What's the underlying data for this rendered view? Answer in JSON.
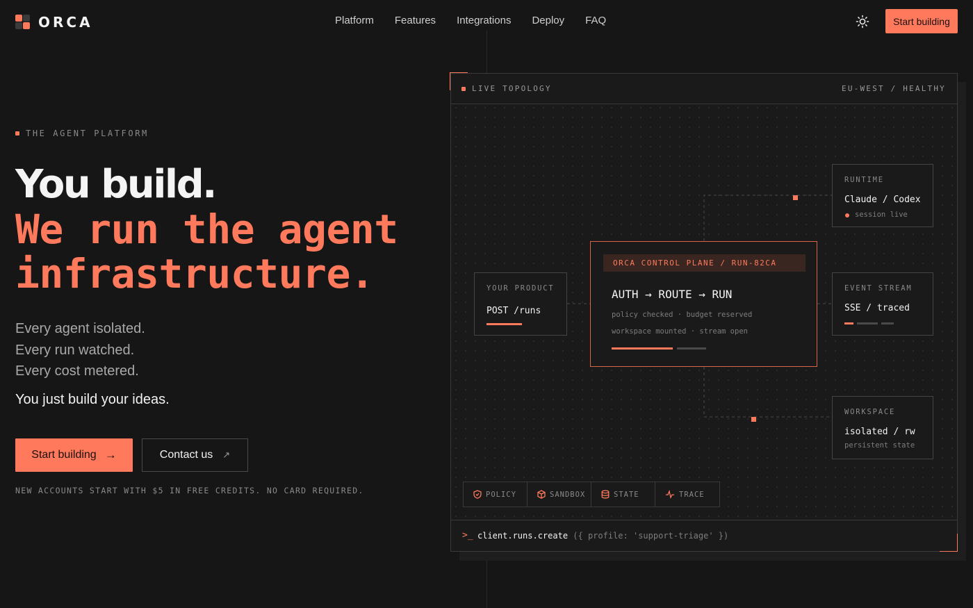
{
  "brand": {
    "name": "ORCA"
  },
  "nav": {
    "links": [
      "Platform",
      "Features",
      "Integrations",
      "Deploy",
      "FAQ"
    ],
    "cta": "Start building",
    "theme_icon": "sun-icon"
  },
  "hero": {
    "eyebrow": "THE AGENT PLATFORM",
    "headline_1": "You build.",
    "headline_2": "We run the agent infrastructure.",
    "lines": [
      "Every agent isolated.",
      "Every run watched.",
      "Every cost metered."
    ],
    "tagline": "You just build your ideas.",
    "primary_cta": "Start building",
    "secondary_cta": "Contact us",
    "fineprint": "NEW ACCOUNTS START WITH $5 IN FREE CREDITS. NO CARD REQUIRED."
  },
  "topology": {
    "label": "LIVE TOPOLOGY",
    "status": "EU-WEST / HEALTHY",
    "product": {
      "label": "YOUR PRODUCT",
      "value": "POST /runs"
    },
    "core": {
      "label": "ORCA CONTROL PLANE / RUN-82CA",
      "title": "AUTH → ROUTE → RUN",
      "meta_1": "policy checked · budget reserved",
      "meta_2": "workspace mounted · stream open",
      "progress": 0.65
    },
    "runtime": {
      "label": "RUNTIME",
      "value": "Claude / Codex",
      "meta": "session live"
    },
    "stream": {
      "label": "EVENT STREAM",
      "value": "SSE / traced"
    },
    "workspace": {
      "label": "WORKSPACE",
      "value": "isolated / rw",
      "meta": "persistent state"
    },
    "pills": [
      {
        "label": "POLICY",
        "icon": "shield-icon"
      },
      {
        "label": "SANDBOX",
        "icon": "cube-icon"
      },
      {
        "label": "STATE",
        "icon": "database-icon"
      },
      {
        "label": "TRACE",
        "icon": "pulse-icon"
      }
    ],
    "command": {
      "prompt": ">_",
      "code": "client.runs.create",
      "args": "({ profile: 'support-triage' })"
    }
  },
  "colors": {
    "accent": "#ff7a5c",
    "background": "#161616"
  }
}
